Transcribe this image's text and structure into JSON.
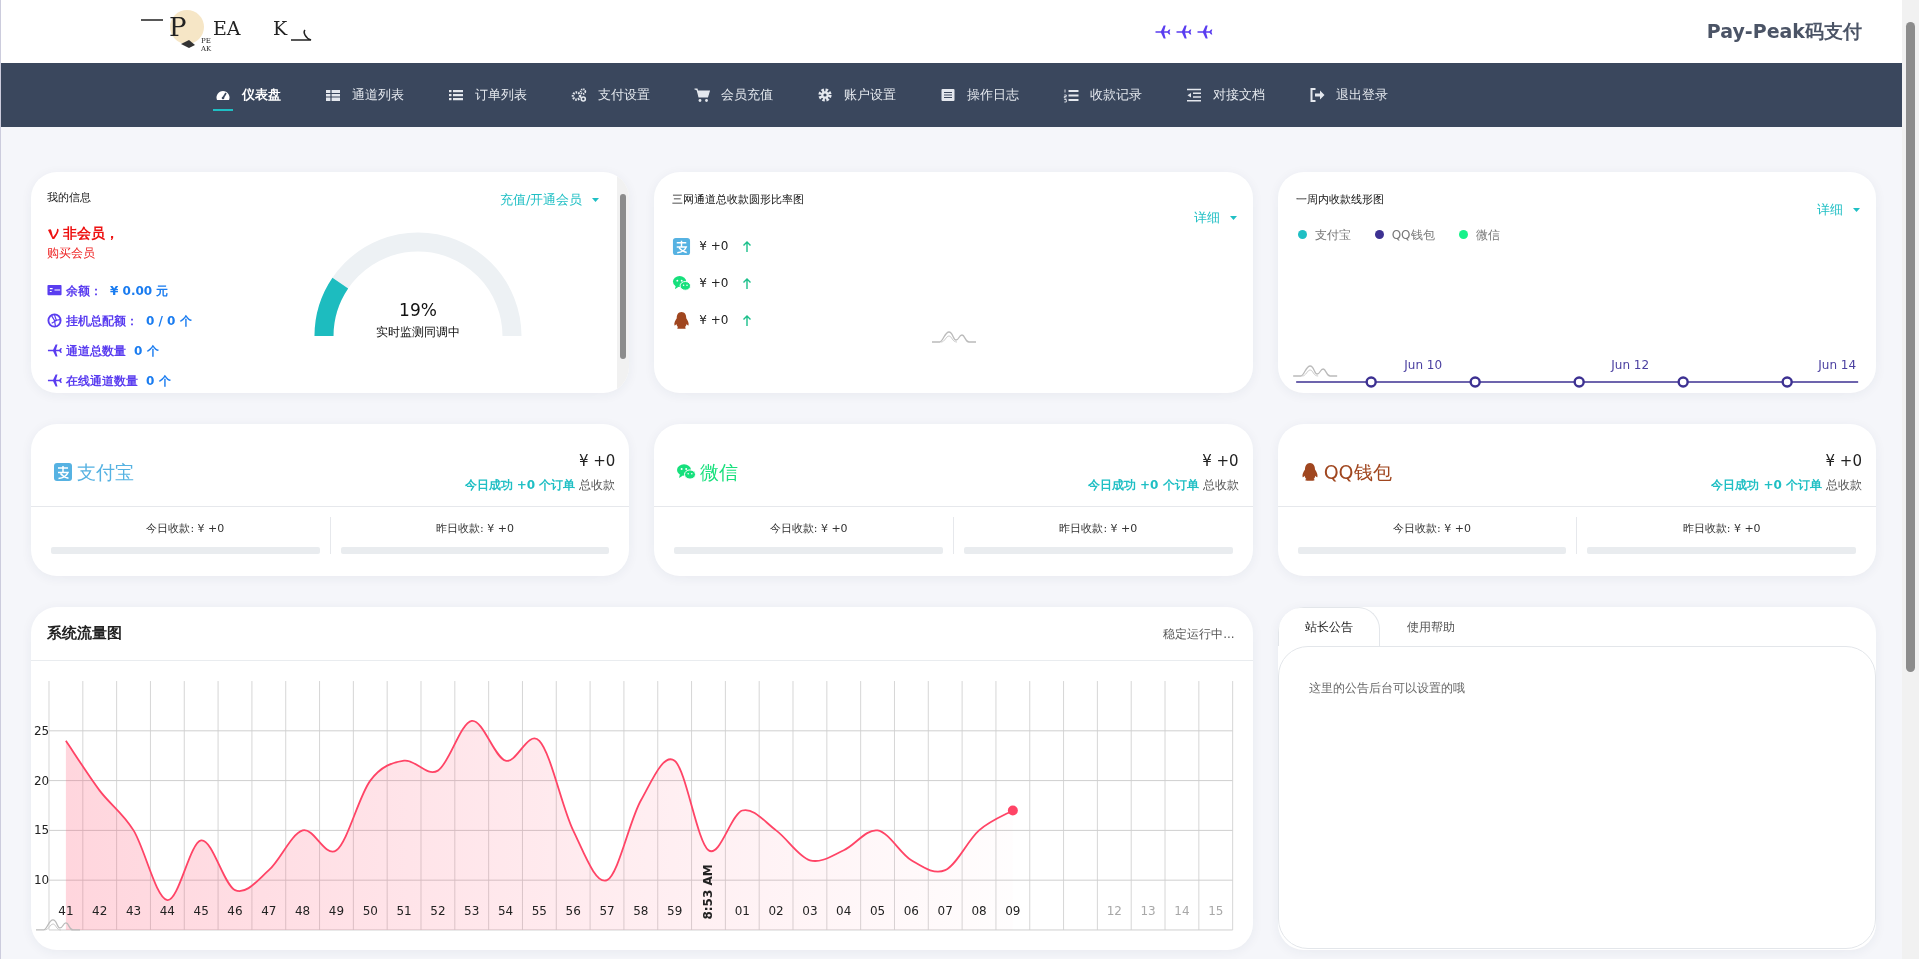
{
  "header": {
    "logo": {
      "letters": [
        "P",
        "EA",
        "K"
      ],
      "sub": [
        "PE",
        "AK"
      ]
    },
    "title": "Pay-Peak码支付"
  },
  "nav": [
    {
      "label": "仪表盘",
      "selected": true
    },
    {
      "label": "通道列表",
      "selected": false
    },
    {
      "label": "订单列表",
      "selected": false
    },
    {
      "label": "支付设置",
      "selected": false
    },
    {
      "label": "会员充值",
      "selected": false
    },
    {
      "label": "账户设置",
      "selected": false
    },
    {
      "label": "操作日志",
      "selected": false
    },
    {
      "label": "收款记录",
      "selected": false
    },
    {
      "label": "对接文档",
      "selected": false
    },
    {
      "label": "退出登录",
      "selected": false
    }
  ],
  "my_info": {
    "title": "我的信息",
    "action": "充值/开通会员",
    "member_status": "非会员，",
    "buy_link": "购买会员",
    "stats": [
      {
        "label": "余额：",
        "value": "¥ 0.00 元"
      },
      {
        "label": "挂机总配额：",
        "value": "0 / 0 个"
      },
      {
        "label": "通道总数量",
        "value": "0 个"
      },
      {
        "label": "在线通道数量",
        "value": "0 个"
      }
    ],
    "gauge": {
      "level": 0.19,
      "reading": "19%",
      "caption": "实时监测同调中"
    }
  },
  "ratio_chart": {
    "title": "三网通道总收款圆形比率图",
    "action": "详细",
    "rows": [
      {
        "kind": "alipay",
        "amount": "¥ +0"
      },
      {
        "kind": "wechat",
        "amount": "¥ +0"
      },
      {
        "kind": "qq",
        "amount": "¥ +0"
      }
    ]
  },
  "week_chart": {
    "title": "一周内收款线形图",
    "action": "详细",
    "legend": [
      {
        "label": "支付宝",
        "color": "#1fbfc4"
      },
      {
        "label": "QQ钱包",
        "color": "#3d3192"
      },
      {
        "label": "微信",
        "color": "#17f28a"
      }
    ],
    "x_labels": [
      "Jun 10",
      "Jun 12",
      "Jun 14"
    ]
  },
  "channels": [
    {
      "kind": "alipay",
      "name": "支付宝",
      "color": "#56b2e2",
      "total": "¥ +0",
      "orders": "今日成功 +0 个订单",
      "orders_suffix": "总收款",
      "today": "今日收款: ¥ +0",
      "yesterday": "昨日收款: ¥ +0"
    },
    {
      "kind": "wechat",
      "name": "微信",
      "color": "#16e07c",
      "total": "¥ +0",
      "orders": "今日成功 +0 个订单",
      "orders_suffix": "总收款",
      "today": "今日收款: ¥ +0",
      "yesterday": "昨日收款: ¥ +0"
    },
    {
      "kind": "qq",
      "name": "QQ钱包",
      "color": "#a0461f",
      "total": "¥ +0",
      "orders": "今日成功 +0 个订单",
      "orders_suffix": "总收款",
      "today": "今日收款: ¥ +0",
      "yesterday": "昨日收款: ¥ +0"
    }
  ],
  "traffic": {
    "title": "系统流量图",
    "status": "稳定运行中...",
    "chart_data": {
      "type": "area",
      "categories": [
        "41",
        "42",
        "43",
        "44",
        "45",
        "46",
        "47",
        "48",
        "49",
        "50",
        "51",
        "52",
        "53",
        "54",
        "55",
        "56",
        "57",
        "58",
        "59",
        "8:53 AM",
        "01",
        "02",
        "03",
        "04",
        "05",
        "06",
        "07",
        "08",
        "09",
        null,
        null,
        "12",
        "13",
        "14",
        "15"
      ],
      "series": [
        {
          "color": "#ff4466",
          "values": [
            24,
            19,
            15,
            8,
            14,
            9,
            11,
            15,
            13,
            20,
            22,
            21,
            26,
            22,
            24,
            15,
            10,
            18,
            22,
            13,
            17,
            15,
            12,
            13,
            15,
            12,
            11,
            15,
            17,
            null,
            null,
            null,
            null,
            null,
            null
          ]
        }
      ],
      "ylim": [
        5,
        30
      ],
      "yticks": [
        10,
        15,
        20,
        25
      ],
      "grid": true
    }
  },
  "notice": {
    "tabs": [
      {
        "label": "站长公告",
        "selected": true
      },
      {
        "label": "使用帮助",
        "selected": false
      }
    ],
    "text": "这里的公告后台可以设置的哦"
  }
}
